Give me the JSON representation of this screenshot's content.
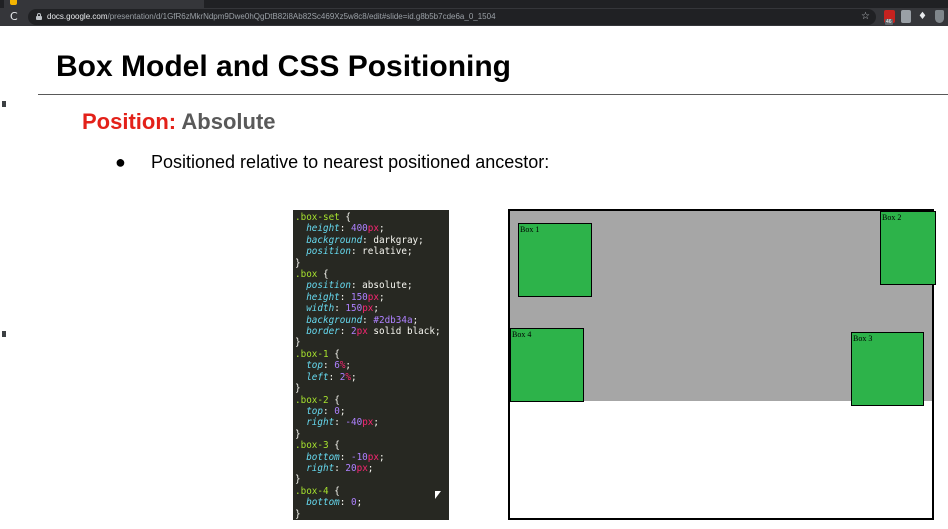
{
  "browser": {
    "reload_glyph": "C",
    "url_host": "docs.google.com",
    "url_path": "/presentation/d/1GfR6zMkrNdpm9Dwe0hQgDtB82i8Ab82Sc469Xz5w8c8/edit#slide=id.g8b5b7cde6a_0_1504",
    "star_glyph": "☆",
    "extension_badge": "46",
    "gem_glyph": "♦"
  },
  "slide": {
    "title": "Box Model and CSS Positioning",
    "subtitle_keyword": "Position:",
    "subtitle_value": "Absolute",
    "bullet_marker": "●",
    "bullet_text": "Positioned relative to nearest positioned ancestor:"
  },
  "code_lines": [
    [
      {
        "t": ".box-set",
        "c": "sel"
      },
      {
        "t": " {",
        "c": "txt"
      }
    ],
    [
      {
        "t": "  height",
        "c": "prop"
      },
      {
        "t": ": ",
        "c": "txt"
      },
      {
        "t": "400",
        "c": "num"
      },
      {
        "t": "px",
        "c": "unit"
      },
      {
        "t": ";",
        "c": "txt"
      }
    ],
    [
      {
        "t": "  background",
        "c": "prop"
      },
      {
        "t": ": darkgray;",
        "c": "txt"
      }
    ],
    [
      {
        "t": "  position",
        "c": "prop"
      },
      {
        "t": ": relative;",
        "c": "txt"
      }
    ],
    [
      {
        "t": "}",
        "c": "txt"
      }
    ],
    [
      {
        "t": ".box",
        "c": "sel"
      },
      {
        "t": " {",
        "c": "txt"
      }
    ],
    [
      {
        "t": "  position",
        "c": "prop"
      },
      {
        "t": ": absolute;",
        "c": "txt"
      }
    ],
    [
      {
        "t": "  height",
        "c": "prop"
      },
      {
        "t": ": ",
        "c": "txt"
      },
      {
        "t": "150",
        "c": "num"
      },
      {
        "t": "px",
        "c": "unit"
      },
      {
        "t": ";",
        "c": "txt"
      }
    ],
    [
      {
        "t": "  width",
        "c": "prop"
      },
      {
        "t": ": ",
        "c": "txt"
      },
      {
        "t": "150",
        "c": "num"
      },
      {
        "t": "px",
        "c": "unit"
      },
      {
        "t": ";",
        "c": "txt"
      }
    ],
    [
      {
        "t": "  background",
        "c": "prop"
      },
      {
        "t": ": ",
        "c": "txt"
      },
      {
        "t": "#2db34a",
        "c": "num"
      },
      {
        "t": ";",
        "c": "txt"
      }
    ],
    [
      {
        "t": "  border",
        "c": "prop"
      },
      {
        "t": ": ",
        "c": "txt"
      },
      {
        "t": "2",
        "c": "num"
      },
      {
        "t": "px",
        "c": "unit"
      },
      {
        "t": " solid black;",
        "c": "txt"
      }
    ],
    [
      {
        "t": "}",
        "c": "txt"
      }
    ],
    [
      {
        "t": ".box-1",
        "c": "sel"
      },
      {
        "t": " {",
        "c": "txt"
      }
    ],
    [
      {
        "t": "  top",
        "c": "prop"
      },
      {
        "t": ": ",
        "c": "txt"
      },
      {
        "t": "6",
        "c": "num"
      },
      {
        "t": "%",
        "c": "unit"
      },
      {
        "t": ";",
        "c": "txt"
      }
    ],
    [
      {
        "t": "  left",
        "c": "prop"
      },
      {
        "t": ": ",
        "c": "txt"
      },
      {
        "t": "2",
        "c": "num"
      },
      {
        "t": "%",
        "c": "unit"
      },
      {
        "t": ";",
        "c": "txt"
      }
    ],
    [
      {
        "t": "}",
        "c": "txt"
      }
    ],
    [
      {
        "t": ".box-2",
        "c": "sel"
      },
      {
        "t": " {",
        "c": "txt"
      }
    ],
    [
      {
        "t": "  top",
        "c": "prop"
      },
      {
        "t": ": ",
        "c": "txt"
      },
      {
        "t": "0",
        "c": "num"
      },
      {
        "t": ";",
        "c": "txt"
      }
    ],
    [
      {
        "t": "  right",
        "c": "prop"
      },
      {
        "t": ": ",
        "c": "txt"
      },
      {
        "t": "-40",
        "c": "num"
      },
      {
        "t": "px",
        "c": "unit"
      },
      {
        "t": ";",
        "c": "txt"
      }
    ],
    [
      {
        "t": "}",
        "c": "txt"
      }
    ],
    [
      {
        "t": ".box-3",
        "c": "sel"
      },
      {
        "t": " {",
        "c": "txt"
      }
    ],
    [
      {
        "t": "  bottom",
        "c": "prop"
      },
      {
        "t": ": ",
        "c": "txt"
      },
      {
        "t": "-10",
        "c": "num"
      },
      {
        "t": "px",
        "c": "unit"
      },
      {
        "t": ";",
        "c": "txt"
      }
    ],
    [
      {
        "t": "  right",
        "c": "prop"
      },
      {
        "t": ": ",
        "c": "txt"
      },
      {
        "t": "20",
        "c": "num"
      },
      {
        "t": "px",
        "c": "unit"
      },
      {
        "t": ";",
        "c": "txt"
      }
    ],
    [
      {
        "t": "}",
        "c": "txt"
      }
    ],
    [
      {
        "t": ".box-4",
        "c": "sel"
      },
      {
        "t": " {",
        "c": "txt"
      }
    ],
    [
      {
        "t": "  bottom",
        "c": "prop"
      },
      {
        "t": ": ",
        "c": "txt"
      },
      {
        "t": "0",
        "c": "num"
      },
      {
        "t": ";",
        "c": "txt"
      }
    ],
    [
      {
        "t": "}",
        "c": "txt"
      }
    ]
  ],
  "demo": {
    "box_color": "#2db34a",
    "set_color": "darkgray",
    "boxes": [
      "Box 1",
      "Box 2",
      "Box 3",
      "Box 4"
    ]
  },
  "colors": {
    "accent_red": "#e32119",
    "code_bg": "#272822",
    "selector": "#a6e22e",
    "property": "#66d9ef",
    "number": "#ae81ff",
    "unit": "#f92672"
  }
}
